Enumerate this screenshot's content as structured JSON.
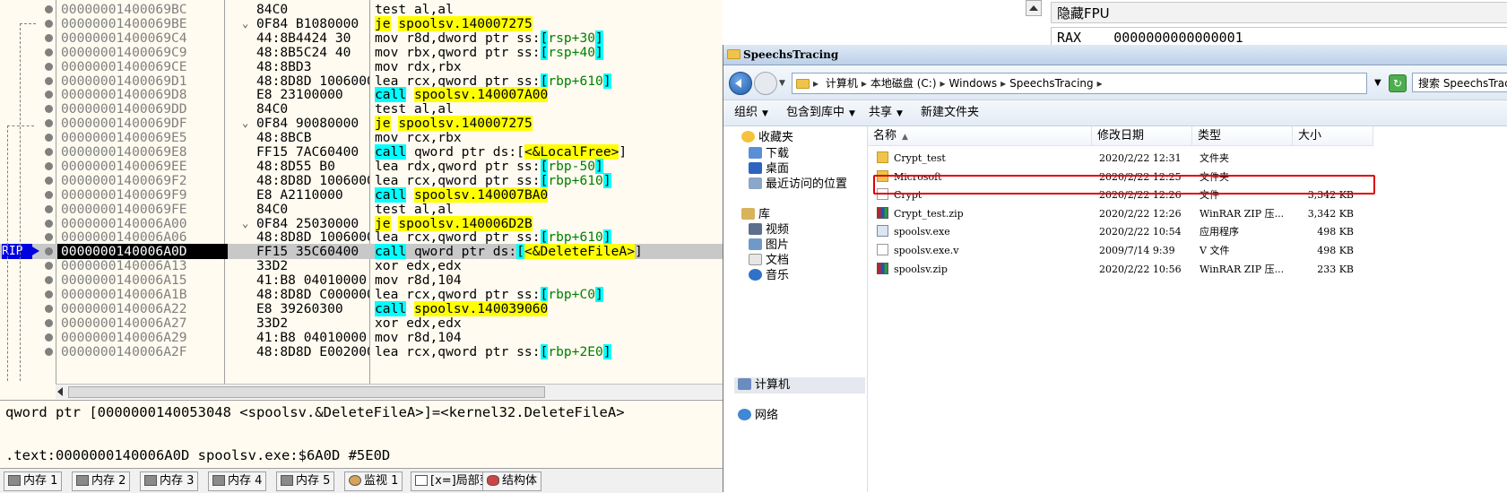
{
  "disasm": {
    "rows": [
      {
        "addr": "00000001400069BC",
        "bytes": "84C0",
        "parts": [
          [
            "test al,al",
            ""
          ]
        ]
      },
      {
        "addr": "00000001400069BE",
        "bytes": "0F84 B1080000",
        "chev": "⌄",
        "parts": [
          [
            "je",
            "y"
          ],
          [
            " ",
            ""
          ],
          [
            "spoolsv.140007275",
            "y"
          ]
        ]
      },
      {
        "addr": "00000001400069C4",
        "bytes": "44:8B4424 30",
        "parts": [
          [
            "mov r8d,dword ptr ss:",
            ""
          ],
          [
            "[",
            "c"
          ],
          [
            "rsp+30",
            "r"
          ],
          [
            "]",
            "c"
          ]
        ]
      },
      {
        "addr": "00000001400069C9",
        "bytes": "48:8B5C24 40",
        "parts": [
          [
            "mov rbx,qword ptr ss:",
            ""
          ],
          [
            "[",
            "c"
          ],
          [
            "rsp+40",
            "r"
          ],
          [
            "]",
            "c"
          ]
        ]
      },
      {
        "addr": "00000001400069CE",
        "bytes": "48:8BD3",
        "parts": [
          [
            "mov rdx,rbx",
            ""
          ]
        ]
      },
      {
        "addr": "00000001400069D1",
        "bytes": "48:8D8D 10060000",
        "parts": [
          [
            "lea rcx,qword ptr ss:",
            ""
          ],
          [
            "[",
            "c"
          ],
          [
            "rbp+610",
            "r"
          ],
          [
            "]",
            "c"
          ]
        ]
      },
      {
        "addr": "00000001400069D8",
        "bytes": "E8 23100000",
        "parts": [
          [
            "call",
            "c"
          ],
          [
            " ",
            ""
          ],
          [
            "spoolsv.140007A00",
            "y"
          ]
        ]
      },
      {
        "addr": "00000001400069DD",
        "bytes": "84C0",
        "parts": [
          [
            "test al,al",
            ""
          ]
        ]
      },
      {
        "addr": "00000001400069DF",
        "bytes": "0F84 90080000",
        "chev": "⌄",
        "parts": [
          [
            "je",
            "y"
          ],
          [
            " ",
            ""
          ],
          [
            "spoolsv.140007275",
            "y"
          ]
        ]
      },
      {
        "addr": "00000001400069E5",
        "bytes": "48:8BCB",
        "parts": [
          [
            "mov rcx,rbx",
            ""
          ]
        ]
      },
      {
        "addr": "00000001400069E8",
        "bytes": "FF15 7AC60400",
        "parts": [
          [
            "call",
            "c"
          ],
          [
            " qword ptr ds:[",
            ""
          ],
          [
            "<&LocalFree>",
            "y"
          ],
          [
            "]",
            ""
          ]
        ]
      },
      {
        "addr": "00000001400069EE",
        "bytes": "48:8D55 B0",
        "parts": [
          [
            "lea rdx,qword ptr ss:",
            ""
          ],
          [
            "[",
            "c"
          ],
          [
            "rbp-50",
            "r"
          ],
          [
            "]",
            "c"
          ]
        ]
      },
      {
        "addr": "00000001400069F2",
        "bytes": "48:8D8D 10060000",
        "parts": [
          [
            "lea rcx,qword ptr ss:",
            ""
          ],
          [
            "[",
            "c"
          ],
          [
            "rbp+610",
            "r"
          ],
          [
            "]",
            "c"
          ]
        ]
      },
      {
        "addr": "00000001400069F9",
        "bytes": "E8 A2110000",
        "parts": [
          [
            "call",
            "c"
          ],
          [
            " ",
            ""
          ],
          [
            "spoolsv.140007BA0",
            "y"
          ]
        ]
      },
      {
        "addr": "00000001400069FE",
        "bytes": "84C0",
        "parts": [
          [
            "test al,al",
            ""
          ]
        ]
      },
      {
        "addr": "0000000140006A00",
        "bytes": "0F84 25030000",
        "chev": "⌄",
        "parts": [
          [
            "je",
            "y"
          ],
          [
            " ",
            ""
          ],
          [
            "spoolsv.140006D2B",
            "y"
          ]
        ]
      },
      {
        "addr": "0000000140006A06",
        "bytes": "48:8D8D 10060000",
        "parts": [
          [
            "lea rcx,qword ptr ss:",
            ""
          ],
          [
            "[",
            "c"
          ],
          [
            "rbp+610",
            "r"
          ],
          [
            "]",
            "c"
          ]
        ]
      },
      {
        "addr": "0000000140006A0D",
        "bytes": "FF15 35C60400",
        "sel": true,
        "parts": [
          [
            "call",
            "c"
          ],
          [
            " qword ptr ds:",
            ""
          ],
          [
            "[",
            "c"
          ],
          [
            "<&DeleteFileA>",
            "y"
          ],
          [
            "]",
            ""
          ]
        ]
      },
      {
        "addr": "0000000140006A13",
        "bytes": "33D2",
        "parts": [
          [
            "xor edx,edx",
            ""
          ]
        ]
      },
      {
        "addr": "0000000140006A15",
        "bytes": "41:B8 04010000",
        "parts": [
          [
            "mov r8d,104",
            ""
          ]
        ]
      },
      {
        "addr": "0000000140006A1B",
        "bytes": "48:8D8D C0000000",
        "parts": [
          [
            "lea rcx,qword ptr ss:",
            ""
          ],
          [
            "[",
            "c"
          ],
          [
            "rbp+C0",
            "r"
          ],
          [
            "]",
            "c"
          ]
        ]
      },
      {
        "addr": "0000000140006A22",
        "bytes": "E8 39260300",
        "parts": [
          [
            "call",
            "c"
          ],
          [
            " ",
            ""
          ],
          [
            "spoolsv.140039060",
            "y"
          ]
        ]
      },
      {
        "addr": "0000000140006A27",
        "bytes": "33D2",
        "parts": [
          [
            "xor edx,edx",
            ""
          ]
        ]
      },
      {
        "addr": "0000000140006A29",
        "bytes": "41:B8 04010000",
        "parts": [
          [
            "mov r8d,104",
            ""
          ]
        ]
      },
      {
        "addr": "0000000140006A2F",
        "bytes": "48:8D8D E0020000",
        "parts": [
          [
            "lea rcx,qword ptr ss:",
            ""
          ],
          [
            "[",
            "c"
          ],
          [
            "rbp+2E0",
            "r"
          ],
          [
            "]",
            "c"
          ]
        ]
      }
    ],
    "rip_label": "RIP"
  },
  "info": {
    "line1": "qword ptr [0000000140053048 <spoolsv.&DeleteFileA>]=<kernel32.DeleteFileA>",
    "line2": ".text:0000000140006A0D spoolsv.exe:$6A0D #5E0D"
  },
  "tabs": [
    {
      "label": "内存 1",
      "icon": "mem"
    },
    {
      "label": "内存 2",
      "icon": "mem"
    },
    {
      "label": "内存 3",
      "icon": "mem"
    },
    {
      "label": "内存 4",
      "icon": "mem"
    },
    {
      "label": "内存 5",
      "icon": "mem"
    },
    {
      "label": "监视 1",
      "icon": "watch"
    },
    {
      "label": "局部变量",
      "icon": "var",
      "prefix": "[x=]"
    },
    {
      "label": "结构体",
      "icon": "struct"
    }
  ],
  "registers": {
    "title": "隐藏FPU",
    "rax_name": "RAX",
    "rax_value": "0000000000000001"
  },
  "explorer": {
    "window_title": "SpeechsTracing",
    "breadcrumbs": [
      "计算机",
      "本地磁盘 (C:)",
      "Windows",
      "SpeechsTracing"
    ],
    "search_placeholder": "搜索 SpeechsTracing",
    "toolbar": [
      "组织",
      "包含到库中",
      "共享",
      "新建文件夹"
    ],
    "nav": {
      "favorites": "收藏夹",
      "downloads": "下载",
      "desktop": "桌面",
      "recent": "最近访问的位置",
      "libraries": "库",
      "videos": "视频",
      "pictures": "图片",
      "documents": "文档",
      "music": "音乐",
      "computer": "计算机",
      "network": "网络"
    },
    "columns": {
      "name": "名称",
      "date": "修改日期",
      "type": "类型",
      "size": "大小"
    },
    "files": [
      {
        "name": "Crypt_test",
        "date": "2020/2/22 12:31",
        "type": "文件夹",
        "size": "",
        "icon": "folder"
      },
      {
        "name": "Microsoft",
        "date": "2020/2/22 12:25",
        "type": "文件夹",
        "size": "",
        "icon": "folder"
      },
      {
        "name": "Crypt",
        "date": "2020/2/22 12:26",
        "type": "文件",
        "size": "3,342 KB",
        "icon": "file",
        "highlighted": true
      },
      {
        "name": "Crypt_test.zip",
        "date": "2020/2/22 12:26",
        "type": "WinRAR ZIP 压...",
        "size": "3,342 KB",
        "icon": "zip"
      },
      {
        "name": "spoolsv.exe",
        "date": "2020/2/22 10:54",
        "type": "应用程序",
        "size": "498 KB",
        "icon": "exe"
      },
      {
        "name": "spoolsv.exe.v",
        "date": "2009/7/14 9:39",
        "type": "V 文件",
        "size": "498 KB",
        "icon": "file"
      },
      {
        "name": "spoolsv.zip",
        "date": "2020/2/22 10:56",
        "type": "WinRAR ZIP 压...",
        "size": "233 KB",
        "icon": "zip"
      }
    ]
  },
  "colors": {
    "jump_highlight": "#ffff00",
    "call_highlight": "#00ffff",
    "rip": "#0000e0",
    "selection_box": "#e00000"
  }
}
